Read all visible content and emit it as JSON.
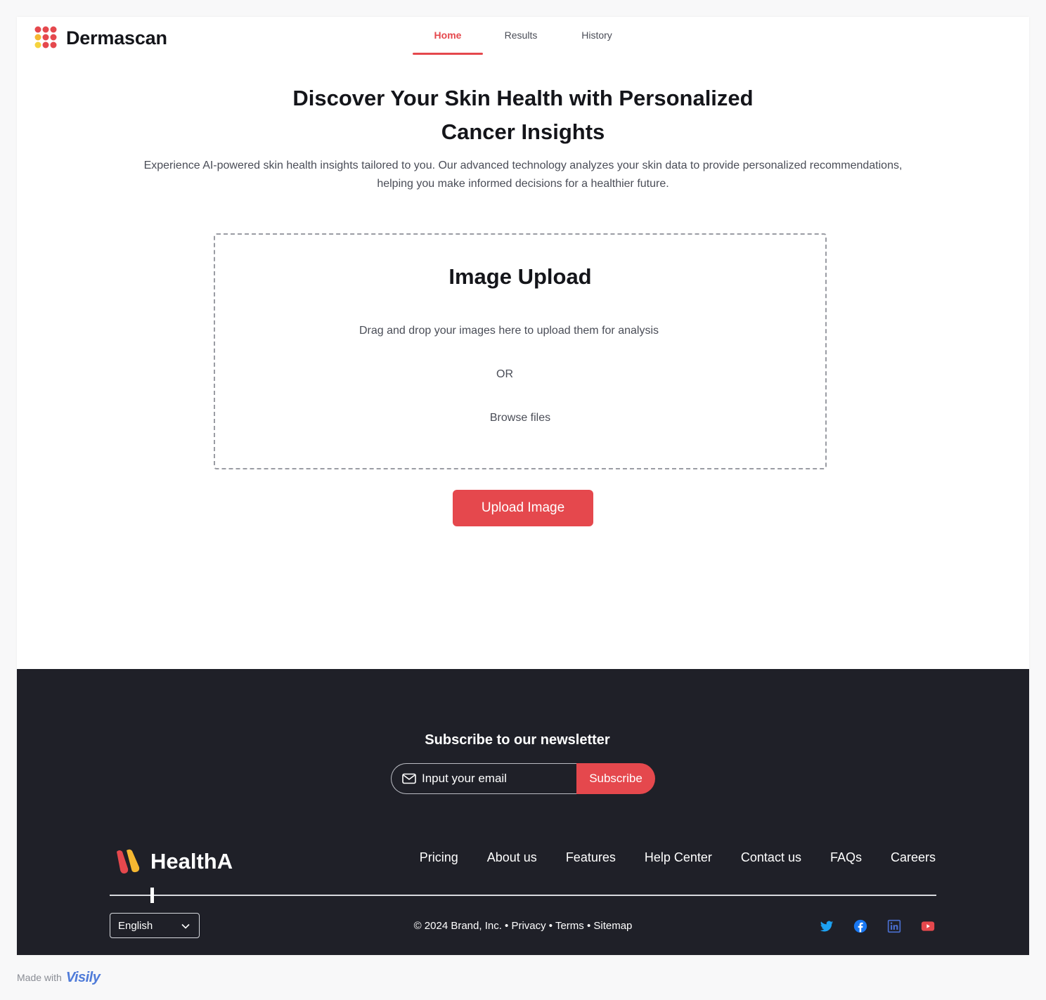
{
  "app": {
    "brand_name": "Dermascan",
    "brand_color": "#e5484d"
  },
  "nav": {
    "tabs": [
      {
        "label": "Home",
        "active": true
      },
      {
        "label": "Results",
        "active": false
      },
      {
        "label": "History",
        "active": false
      }
    ]
  },
  "hero": {
    "title_line1": "Discover Your Skin Health with Personalized",
    "title_line2": "Cancer Insights",
    "subtitle_line1": "Experience AI-powered skin health insights tailored to you. Our advanced technology analyzes your skin data to provide personalized recommendations,",
    "subtitle_line2": "helping you make informed decisions for a healthier future."
  },
  "upload": {
    "title": "Image Upload",
    "drag_text": "Drag and drop your images here to upload them for analysis",
    "or_text": "OR",
    "browse_label": "Browse files",
    "button_label": "Upload Image"
  },
  "footer": {
    "newsletter_title": "Subscribe to our newsletter",
    "email_placeholder": "Input your email",
    "subscribe_label": "Subscribe",
    "brand_name": "HealthA",
    "links": [
      "Pricing",
      "About us",
      "Features",
      "Help Center",
      "Contact us",
      "FAQs",
      "Careers"
    ],
    "language": "English",
    "copyright": "© 2024 Brand, Inc. • Privacy • Terms • Sitemap",
    "socials": [
      {
        "icon": "twitter-icon",
        "color": "#1da1f2"
      },
      {
        "icon": "facebook-icon",
        "color": "#1877f2"
      },
      {
        "icon": "linkedin-icon",
        "color": "#4a6fd1"
      },
      {
        "icon": "youtube-icon",
        "color": "#e5484d"
      }
    ],
    "background": "#1f2028"
  },
  "made_with": {
    "text": "Made with",
    "logo_text": "Visily"
  }
}
